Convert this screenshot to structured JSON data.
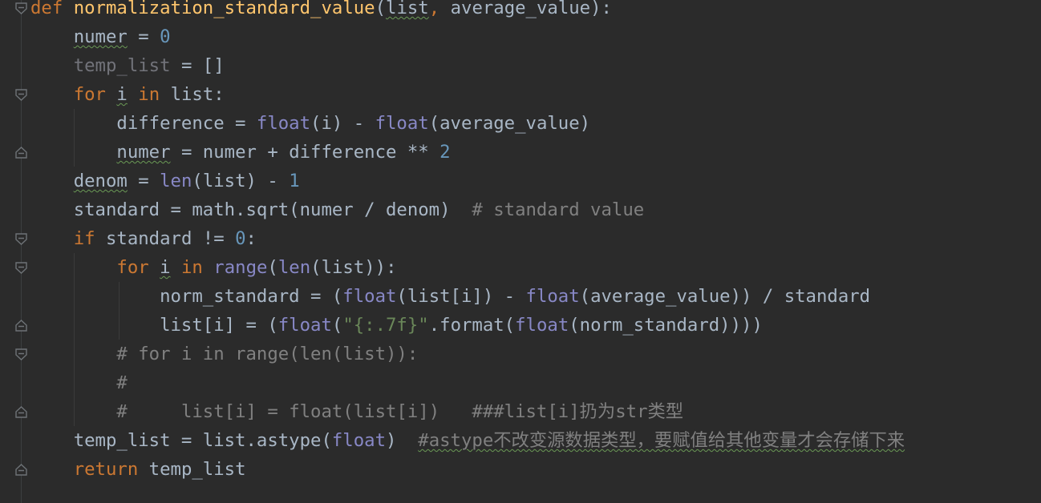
{
  "editor": {
    "language": "Python",
    "colors": {
      "background": "#2b2b2b",
      "default_text": "#a9b7c6",
      "keyword": "#cc7832",
      "function_def": "#ffc66d",
      "builtin": "#8888c6",
      "number": "#6897bb",
      "string": "#6a8759",
      "comment": "#808080",
      "unused_variable": "#72737a",
      "typo_underline": "#6a9955"
    },
    "lines": [
      {
        "id": "l1",
        "fold": "open",
        "tokens": [
          {
            "t": "def",
            "k": "kw"
          },
          {
            "t": " "
          },
          {
            "t": "normalization_standard_value",
            "k": "fn"
          },
          {
            "t": "("
          },
          {
            "t": "list",
            "k": "squig"
          },
          {
            "t": ", ",
            "k": "kw"
          },
          {
            "t": "average_value"
          },
          {
            "t": "):"
          }
        ]
      },
      {
        "id": "l2",
        "tokens": [
          {
            "t": "    "
          },
          {
            "t": "numer",
            "k": "squig"
          },
          {
            "t": " = "
          },
          {
            "t": "0",
            "k": "num"
          }
        ]
      },
      {
        "id": "l3",
        "tokens": [
          {
            "t": "    "
          },
          {
            "t": "temp_list",
            "k": "unused"
          },
          {
            "t": " = []"
          }
        ]
      },
      {
        "id": "l4",
        "fold": "open",
        "tokens": [
          {
            "t": "    "
          },
          {
            "t": "for",
            "k": "kw"
          },
          {
            "t": " "
          },
          {
            "t": "i",
            "k": "squig"
          },
          {
            "t": " "
          },
          {
            "t": "in",
            "k": "kw"
          },
          {
            "t": " list:"
          }
        ]
      },
      {
        "id": "l5",
        "tokens": [
          {
            "t": "        difference = "
          },
          {
            "t": "float",
            "k": "bi"
          },
          {
            "t": "(i) - "
          },
          {
            "t": "float",
            "k": "bi"
          },
          {
            "t": "(average_value)"
          }
        ]
      },
      {
        "id": "l6",
        "fold": "close",
        "tokens": [
          {
            "t": "        "
          },
          {
            "t": "numer",
            "k": "squig"
          },
          {
            "t": " = numer + difference ** "
          },
          {
            "t": "2",
            "k": "num"
          }
        ]
      },
      {
        "id": "l7",
        "tokens": [
          {
            "t": "    "
          },
          {
            "t": "denom",
            "k": "squig"
          },
          {
            "t": " = "
          },
          {
            "t": "len",
            "k": "bi"
          },
          {
            "t": "(list) - "
          },
          {
            "t": "1",
            "k": "num"
          }
        ]
      },
      {
        "id": "l8",
        "tokens": [
          {
            "t": "    standard = math.sqrt(numer / denom)  "
          },
          {
            "t": "# standard value",
            "k": "cmt"
          }
        ]
      },
      {
        "id": "l9",
        "fold": "open",
        "tokens": [
          {
            "t": "    "
          },
          {
            "t": "if",
            "k": "kw"
          },
          {
            "t": " standard != "
          },
          {
            "t": "0",
            "k": "num"
          },
          {
            "t": ":"
          }
        ]
      },
      {
        "id": "l10",
        "fold": "open",
        "tokens": [
          {
            "t": "        "
          },
          {
            "t": "for",
            "k": "kw"
          },
          {
            "t": " "
          },
          {
            "t": "i",
            "k": "squig"
          },
          {
            "t": " "
          },
          {
            "t": "in",
            "k": "kw"
          },
          {
            "t": " "
          },
          {
            "t": "range",
            "k": "bi"
          },
          {
            "t": "("
          },
          {
            "t": "len",
            "k": "bi"
          },
          {
            "t": "(list)):"
          }
        ]
      },
      {
        "id": "l11",
        "tokens": [
          {
            "t": "            norm_standard = ("
          },
          {
            "t": "float",
            "k": "bi"
          },
          {
            "t": "(list[i]) - "
          },
          {
            "t": "float",
            "k": "bi"
          },
          {
            "t": "(average_value)) / standard"
          }
        ]
      },
      {
        "id": "l12",
        "fold": "close",
        "tokens": [
          {
            "t": "            list[i] = ("
          },
          {
            "t": "float",
            "k": "bi"
          },
          {
            "t": "("
          },
          {
            "t": "\"{:.7f}\"",
            "k": "str"
          },
          {
            "t": ".format("
          },
          {
            "t": "float",
            "k": "bi"
          },
          {
            "t": "(norm_standard))))"
          }
        ]
      },
      {
        "id": "l13",
        "fold": "open",
        "tokens": [
          {
            "t": "        "
          },
          {
            "t": "# for i in range(len(list)):",
            "k": "cmt"
          }
        ]
      },
      {
        "id": "l14",
        "tokens": [
          {
            "t": "        "
          },
          {
            "t": "#",
            "k": "cmt"
          }
        ]
      },
      {
        "id": "l15",
        "fold": "close",
        "tokens": [
          {
            "t": "        "
          },
          {
            "t": "#     list[i] = float(list[i])   ###list[i]扔为str类型",
            "k": "cmt"
          }
        ]
      },
      {
        "id": "l16",
        "tokens": [
          {
            "t": "    temp_list = list.astype("
          },
          {
            "t": "float",
            "k": "bi"
          },
          {
            "t": ")  "
          },
          {
            "t": "#astype不改变源数据类型，要赋值给其他变量才会存储下来",
            "k": "cmt squig"
          }
        ]
      },
      {
        "id": "l17",
        "fold": "close",
        "tokens": [
          {
            "t": "    "
          },
          {
            "t": "return",
            "k": "kw"
          },
          {
            "t": " temp_list"
          }
        ]
      }
    ]
  }
}
